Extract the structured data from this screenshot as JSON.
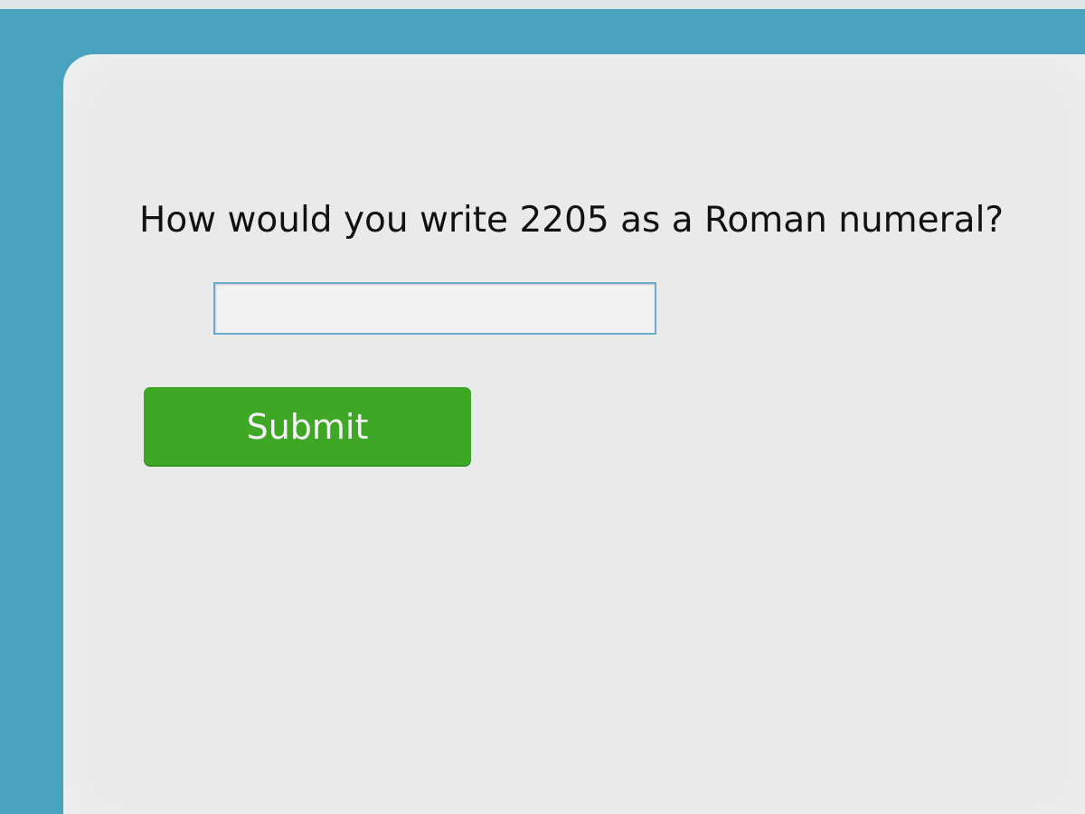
{
  "question": {
    "text": "How would you write 2205 as a Roman numeral?"
  },
  "answer": {
    "value": "",
    "placeholder": ""
  },
  "actions": {
    "submit_label": "Submit"
  },
  "colors": {
    "page_background": "#4aa3be",
    "panel_background": "#e9eaea",
    "submit_button": "#3ea726",
    "input_border": "#6aa9c8"
  }
}
